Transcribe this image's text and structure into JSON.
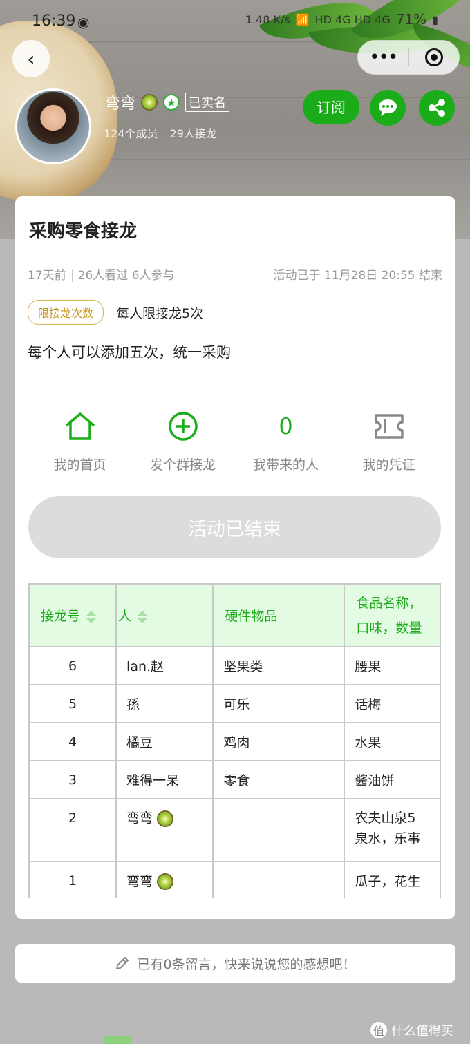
{
  "status_bar": {
    "time": "16:39",
    "net_speed": "1.48 K/s",
    "signal": "HD 4G HD 4G",
    "battery": "71%"
  },
  "profile": {
    "name": "弯弯",
    "verified_label": "已实名",
    "members": "124个成员",
    "relays": "29人接龙",
    "subscribe_label": "订阅"
  },
  "activity": {
    "title": "采购零食接龙",
    "posted": "17天前",
    "views": "26人看过",
    "participants": "6人参与",
    "end_time": "活动已于 11月28日 20:55 结束",
    "limit_tag": "限接龙次数",
    "limit_text": "每人限接龙5次",
    "description": "每个人可以添加五次，统一采购",
    "ended_button": "活动已结束"
  },
  "quick_actions": [
    {
      "label": "我的首页",
      "icon": "home-icon"
    },
    {
      "label": "发个群接龙",
      "icon": "plus-circle-icon"
    },
    {
      "label": "我带来的人",
      "value": "0"
    },
    {
      "label": "我的凭证",
      "icon": "ticket-icon"
    }
  ],
  "table": {
    "headers": [
      "接龙号",
      "接龙人",
      "硬件物品",
      "食品名称，口味，数量"
    ],
    "rows": [
      {
        "no": "6",
        "person": "lan.赵",
        "item": "坚果类",
        "food": "腰果"
      },
      {
        "no": "5",
        "person": "孫",
        "item": "可乐",
        "food": "话梅"
      },
      {
        "no": "4",
        "person": "橘豆",
        "item": "鸡肉",
        "food": "水果"
      },
      {
        "no": "3",
        "person": "难得一呆",
        "item": "零食",
        "food": "酱油饼"
      },
      {
        "no": "2",
        "person": "弯弯",
        "item": "",
        "food": "农夫山泉5",
        "food2": "泉水，乐事"
      },
      {
        "no": "1",
        "person": "弯弯",
        "item": "",
        "food": "瓜子，花生"
      }
    ]
  },
  "comment_bar": {
    "text": "已有0条留言，快来说说您的感想吧！"
  },
  "watermark": {
    "text": "什么值得买"
  },
  "colors": {
    "brand_green": "#1aad19",
    "tag_gold": "#c8961e",
    "header_bg": "#e3fbe3"
  }
}
